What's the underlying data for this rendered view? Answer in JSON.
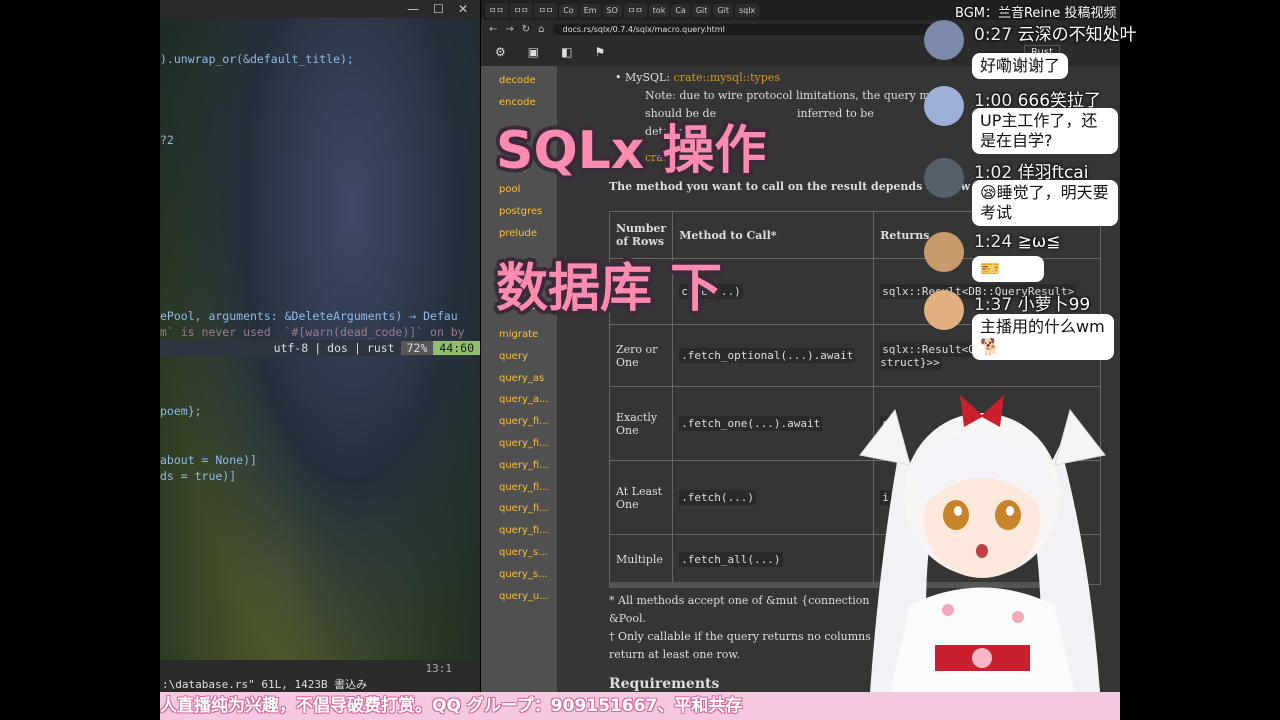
{
  "editor": {
    "lines": [
      ").unwrap_or(&default_title);",
      "?2",
      "ePool, arguments: &DeleteArguments) → Defau",
      "m` is never used  `#[warn(dead_code)]` on by",
      "poem};",
      "about = None)]",
      "ds = true)]"
    ],
    "status": {
      "encoding": "utf-8",
      "lineend": "dos",
      "filetype": "rust",
      "percent": "72%",
      "position": "44:60"
    },
    "cursor_pos": "13:1",
    "file_info": ":\\database.rs\" 61L, 1423B 書込み"
  },
  "browser": {
    "tabs": [
      "ㅁㅁ",
      "ㅁㅁ",
      "ㅁㅁ",
      "Co",
      "Em",
      "SO",
      "ㅁㅁ",
      "tok",
      "Ca",
      "Git",
      "Git",
      "sqlx"
    ],
    "url": "docs.rs/sqlx/0.7.4/sqlx/macro.query.html",
    "rust_label": "Rust",
    "sidebar": [
      "decode",
      "encode",
      "",
      "",
      "mysql",
      "pool",
      "postgres",
      "prelude",
      "",
      "types"
    ],
    "macros_heading": "Macros",
    "macros": [
      "migrate",
      "query",
      "query_as",
      "query_a...",
      "query_fi...",
      "query_fi...",
      "query_fi...",
      "query_fi...",
      "query_fi...",
      "query_fi...",
      "query_s...",
      "query_s...",
      "query_u..."
    ],
    "bullet": "MySQL:",
    "bullet_link": "crate::mysql::types",
    "note1": "Note: due to wire protocol limitations, the query mac",
    "note2": "should be de",
    "note3": "inferred to be",
    "note4": "details.",
    "link2": "crate::s",
    "method_para": "The method you want to call on the result depends on how",
    "table_headers": [
      "Number of Rows",
      "Method to Call*",
      "Returns"
    ],
    "rows": [
      {
        "rows": "",
        "method": "cute(...)",
        "returns": "sqlx::Result<DB::QueryResult>"
      },
      {
        "rows": "Zero or One",
        "method": ".fetch_optional(...).await",
        "returns": "sqlx::Result<Option<{adhoc struct}>>"
      },
      {
        "rows": "Exactly One",
        "method": ".fetch_one(...).await",
        "returns": "s"
      },
      {
        "rows": "At Least One",
        "method": ".fetch(...)",
        "returns": "i"
      },
      {
        "rows": "Multiple",
        "method": ".fetch_all(...)",
        "returns": "s"
      }
    ],
    "footnote1": "* All methods accept one of &mut {connection",
    "footnote1b": "&Pool.",
    "footnote2": "† Only callable if the query returns no columns",
    "footnote2b": "return at least one row.",
    "requirements": "Requirements"
  },
  "overlay": {
    "title1": "SQLx 操作",
    "title2": "数据库 下"
  },
  "topbar": "BGM：兰音Reine 投稿视频",
  "chat": [
    {
      "time": "0:27",
      "name": "云深の不知处叶",
      "text": "好嘞谢谢了",
      "avatar_color": "#7a8aa8"
    },
    {
      "time": "1:00",
      "name": "666笑拉了",
      "text": "UP主工作了，还是在自学?",
      "avatar_color": "#9fb0d8"
    },
    {
      "time": "1:02",
      "name": "佯羽ftcai",
      "text": "😪睡觉了，明天要考试",
      "avatar_color": "#55606a"
    },
    {
      "time": "1:24",
      "name": "≧ω≦",
      "text": "🎫",
      "avatar_color": "#c79a6a"
    },
    {
      "time": "1:37",
      "name": "小萝卜99",
      "text": "主播用的什么wm🐕",
      "avatar_color": "#e2b080"
    }
  ],
  "ticker": "人直播纯为兴趣，不倡导破费打赏。QQ グループ：909151667、平和共存"
}
